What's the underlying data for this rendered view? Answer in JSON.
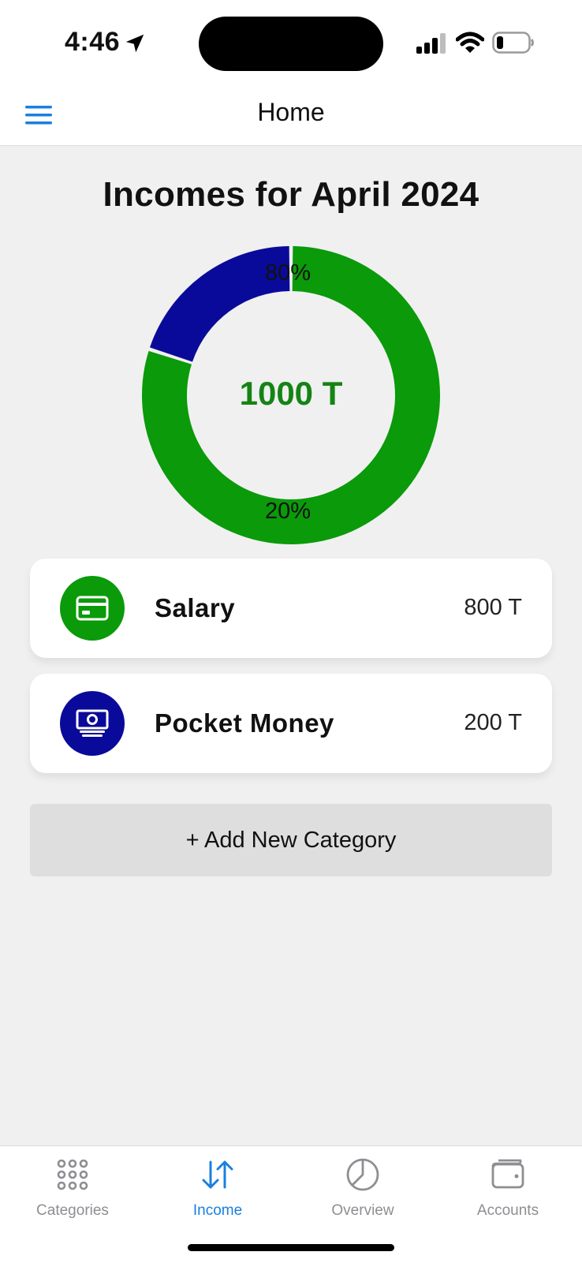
{
  "status_bar": {
    "time": "4:46"
  },
  "nav": {
    "title": "Home",
    "menu_icon": "hamburger-menu-icon"
  },
  "main": {
    "title": "Incomes for April 2024",
    "total": "1000 T",
    "chart_labels": {
      "top": "80%",
      "bottom": "20%"
    },
    "categories": [
      {
        "name": "Salary",
        "amount": "800 T",
        "icon": "credit-card-icon",
        "color": "#0a9a0a"
      },
      {
        "name": "Pocket Money",
        "amount": "200 T",
        "icon": "banknote-icon",
        "color": "#0a0a9a"
      }
    ],
    "add_button": "+ Add New Category"
  },
  "chart_data": {
    "type": "pie",
    "categories": [
      "Salary",
      "Pocket Money"
    ],
    "values": [
      800,
      200
    ],
    "percent_labels": [
      "80%",
      "20%"
    ],
    "colors": [
      "#0a9a0a",
      "#0a0a9a"
    ],
    "center_label": "1000 T"
  },
  "tabs": [
    {
      "label": "Categories",
      "icon": "grid-icon",
      "active": false
    },
    {
      "label": "Income",
      "icon": "arrows-up-down-icon",
      "active": true
    },
    {
      "label": "Overview",
      "icon": "pie-chart-icon",
      "active": false
    },
    {
      "label": "Accounts",
      "icon": "wallet-icon",
      "active": false
    }
  ],
  "colors": {
    "accent": "#1a7fe0",
    "total_text": "#148414",
    "background": "#f0f0f0"
  }
}
